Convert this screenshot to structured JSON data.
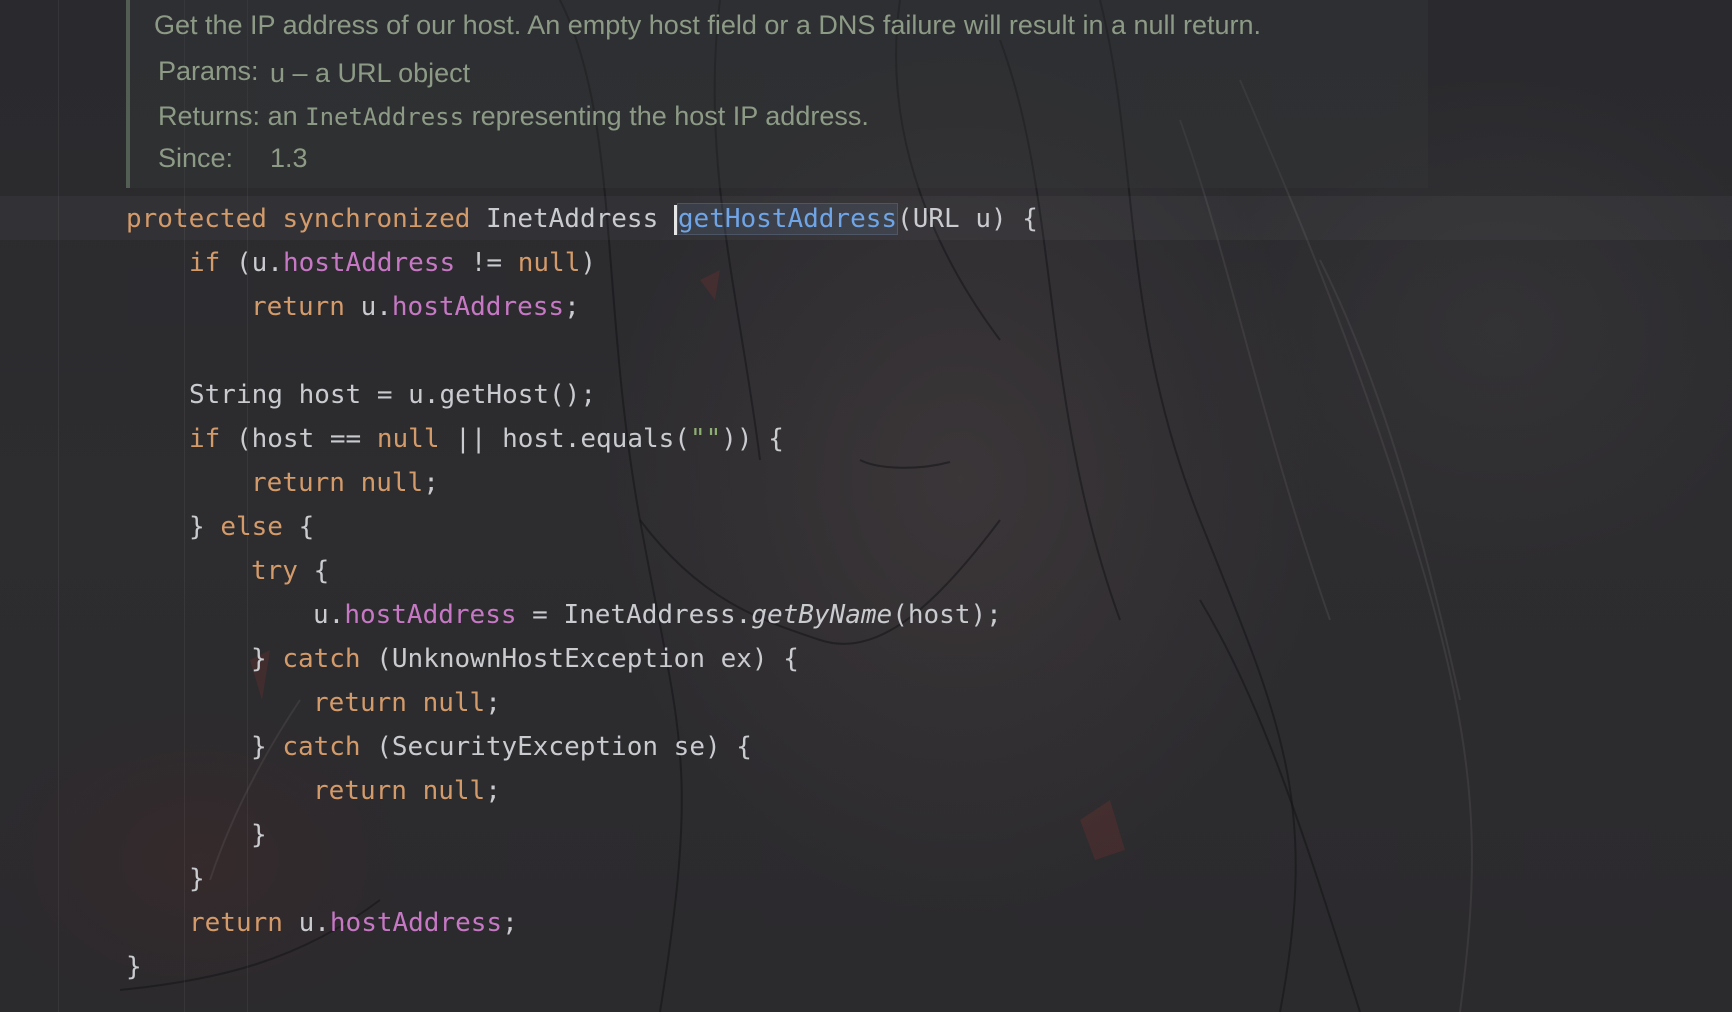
{
  "doc": {
    "summary": "Get the IP address of our host. An empty host field or a DNS failure will result in a null return.",
    "params_label": "Params:",
    "params_value": "u – a URL object",
    "returns_label": "Returns:",
    "returns_pre": "an",
    "returns_code": "InetAddress",
    "returns_post": "representing the host IP address.",
    "since_label": "Since:",
    "since_value": "1.3"
  },
  "code": {
    "l1": {
      "kw1": "protected",
      "kw2": "synchronized",
      "type": " InetAddress ",
      "fn": "getHostAddress",
      "rest": "(URL u) {"
    },
    "l2": {
      "kw": "if",
      "a": " (u.",
      "fld": "hostAddress",
      "b": " != ",
      "kw2": "null",
      "c": ")"
    },
    "l3": {
      "kw": "return",
      "a": " u.",
      "fld": "hostAddress",
      "b": ";"
    },
    "l4": {
      "a": "String host = u.getHost();"
    },
    "l5": {
      "kw": "if",
      "a": " (host == ",
      "kw2": "null",
      "b": " || host.equals(",
      "str": "\"\"",
      "c": ")) {"
    },
    "l6": {
      "kw": "return",
      "sp": " ",
      "kw2": "null",
      "a": ";"
    },
    "l7": {
      "a": "} ",
      "kw": "else",
      "b": " {"
    },
    "l8": {
      "kw": "try",
      "a": " {"
    },
    "l9": {
      "a": "u.",
      "fld": "hostAddress",
      "b": " = InetAddress.",
      "fn": "getByName",
      "c": "(host);"
    },
    "l10": {
      "a": "} ",
      "kw": "catch",
      "b": " (UnknownHostException ex) {"
    },
    "l11": {
      "kw": "return",
      "sp": " ",
      "kw2": "null",
      "a": ";"
    },
    "l12": {
      "a": "} ",
      "kw": "catch",
      "b": " (SecurityException se) {"
    },
    "l13": {
      "kw": "return",
      "sp": " ",
      "kw2": "null",
      "a": ";"
    },
    "l14": {
      "a": "}"
    },
    "l15": {
      "a": "}"
    },
    "l16": {
      "kw": "return",
      "a": " u.",
      "fld": "hostAddress",
      "b": ";"
    },
    "l17": {
      "a": "}"
    }
  },
  "colors": {
    "keyword": "#d39a6a",
    "field": "#c678c4",
    "method_highlight": "#6fa5e6",
    "plain": "#c9cbcf",
    "doc_text": "#8d9b86"
  }
}
